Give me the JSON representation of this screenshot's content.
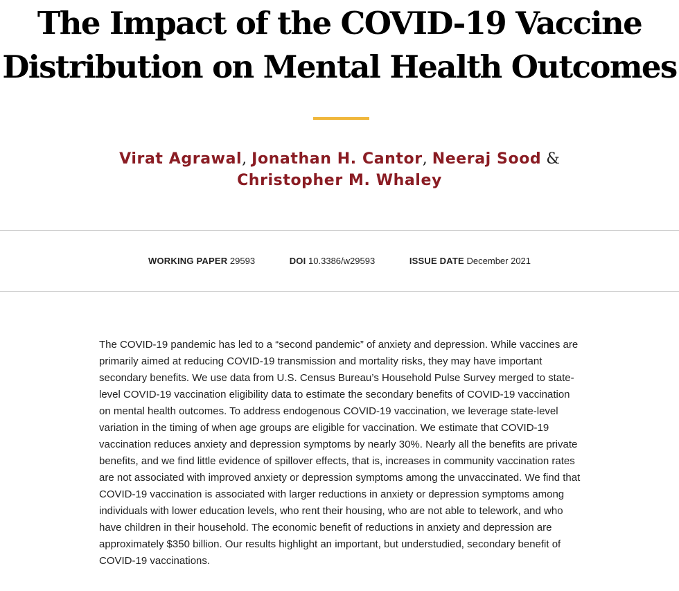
{
  "paper": {
    "title_line1": "The Impact of the COVID-19 Vaccine",
    "title_line2": "Distribution on Mental Health Outcomes",
    "authors": [
      {
        "name": "Virat Agrawal"
      },
      {
        "name": "Jonathan H. Cantor"
      },
      {
        "name": "Neeraj Sood"
      },
      {
        "name": "Christopher M. Whaley"
      }
    ],
    "author_separators": [
      ",",
      ",",
      "&"
    ],
    "meta": {
      "working_paper_label": "WORKING PAPER",
      "working_paper_value": "29593",
      "doi_label": "DOI",
      "doi_value": "10.3386/w29593",
      "issue_date_label": "ISSUE DATE",
      "issue_date_value": "December 2021"
    },
    "abstract": "The COVID-19 pandemic has led to a “second pandemic” of anxiety and depression. While vaccines are primarily aimed at reducing COVID-19 transmission and mortality risks, they may have important secondary benefits. We use data from U.S. Census Bureau’s Household Pulse Survey merged to state-level COVID-19 vaccination eligibility data to estimate the secondary benefits of COVID-19 vaccination on mental health outcomes. To address endogenous COVID-19 vaccination, we leverage state-level variation in the timing of when age groups are eligible for vaccination. We estimate that COVID-19 vaccination reduces anxiety and depression symptoms by nearly 30%. Nearly all the benefits are private benefits, and we find little evidence of spillover effects, that is, increases in community vaccination rates are not associated with improved anxiety or depression symptoms among the unvaccinated. We find that COVID-19 vaccination is associated with larger reductions in anxiety or depression symptoms among individuals with lower education levels, who rent their housing, who are not able to telework, and who have children in their household. The economic benefit of reductions in anxiety and depression are approximately $350 billion. Our results highlight an important, but understudied, secondary benefit of COVID-19 vaccinations."
  },
  "colors": {
    "author_link": "#8a1c23",
    "accent_bar": "#f0b73b",
    "rule": "#cccccc",
    "text": "#222222",
    "title": "#000000"
  }
}
